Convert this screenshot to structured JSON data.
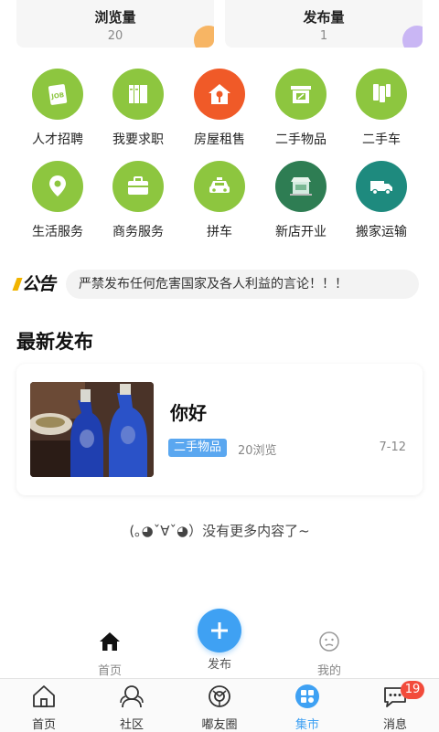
{
  "stats": {
    "views_label": "浏览量",
    "views_value": "20",
    "posts_label": "发布量",
    "posts_value": "1",
    "views_color": "#f7b564",
    "posts_color": "#c9b6f4"
  },
  "categories": [
    {
      "label": "人才招聘",
      "icon": "job-card-icon",
      "color": "#8dc63f"
    },
    {
      "label": "我要求职",
      "icon": "folders-icon",
      "color": "#8dc63f"
    },
    {
      "label": "房屋租售",
      "icon": "house-key-icon",
      "color": "#f05a28"
    },
    {
      "label": "二手物品",
      "icon": "shop-icon",
      "color": "#8dc63f"
    },
    {
      "label": "二手车",
      "icon": "car-icon",
      "color": "#8dc63f"
    },
    {
      "label": "生活服务",
      "icon": "location-pin-icon",
      "color": "#8dc63f"
    },
    {
      "label": "商务服务",
      "icon": "briefcase-icon",
      "color": "#8dc63f"
    },
    {
      "label": "拼车",
      "icon": "taxi-icon",
      "color": "#8dc63f"
    },
    {
      "label": "新店开业",
      "icon": "storefront-icon",
      "color": "#2e7d53"
    },
    {
      "label": "搬家运输",
      "icon": "truck-icon",
      "color": "#1e8a7e"
    }
  ],
  "notice": {
    "logo": "公告",
    "text": "严禁发布任何危害国家及各人利益的言论！！！"
  },
  "latest": {
    "title": "最新发布",
    "post": {
      "title": "你好",
      "tag": "二手物品",
      "views": "20浏览",
      "date": "7-12"
    }
  },
  "end_text": "(｡◕ˇ∀ˇ◕）没有更多内容了~",
  "mini_tabs": {
    "home": "首页",
    "publish": "发布",
    "mine": "我的"
  },
  "tabbar": {
    "items": [
      {
        "label": "首页",
        "icon": "home-icon"
      },
      {
        "label": "社区",
        "icon": "community-icon"
      },
      {
        "label": "嘟友圈",
        "icon": "moments-icon"
      },
      {
        "label": "集市",
        "icon": "market-icon",
        "active": true
      },
      {
        "label": "消息",
        "icon": "message-icon",
        "badge": "19"
      }
    ],
    "active_color": "#3fa1f3",
    "badge_color": "#f24b3b"
  }
}
